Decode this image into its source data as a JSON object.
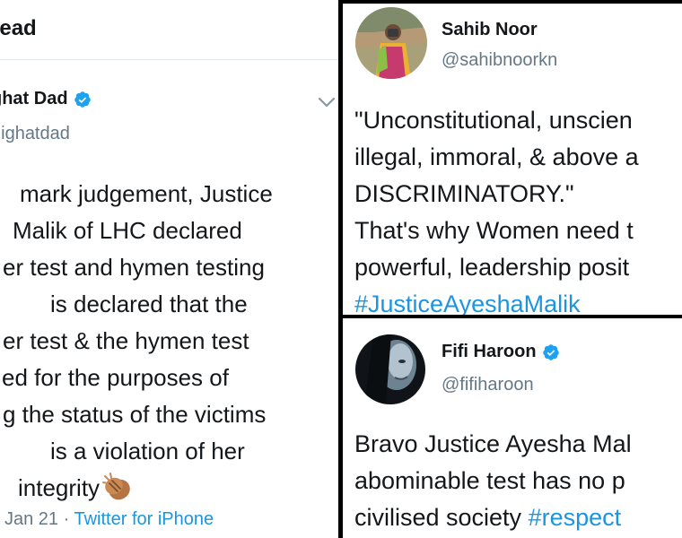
{
  "left_tweet": {
    "header": "read",
    "author_name": "ghat Dad",
    "author_handle": "nighatdad",
    "lines": [
      "mark judgement, Justice",
      "Malik of LHC declared",
      "er test and hymen testing",
      "is declared that the",
      "er test & the hymen test",
      "ed for the purposes of",
      "g the status of the victims",
      "is a violation of her",
      "integrity"
    ],
    "emoji": "clapping-hands",
    "date": "Jan 21",
    "separator": "·",
    "source": "Twitter for iPhone"
  },
  "top_right_tweet": {
    "author_name": "Sahib Noor",
    "author_handle": "@sahibnoorkn",
    "lines": [
      "\"Unconstitutional, unscien",
      "illegal, immoral, & above a",
      "DISCRIMINATORY.\"",
      "That's why Women need t",
      "powerful, leadership posit"
    ],
    "hashtag": "#JusticeAyeshaMalik"
  },
  "bottom_right_tweet": {
    "author_name": "Fifi Haroon",
    "author_handle": "@fifiharoon",
    "line1": "Bravo Justice Ayesha Mal",
    "line2": "abominable test has no p",
    "line3_text": "civilised society",
    "line3_hashtag": "#respect"
  },
  "colors": {
    "text": "#14171a",
    "secondary": "#657786",
    "link": "#1b95e0",
    "verified": "#1da1f2",
    "background": "#ffffff",
    "divider": "#000000"
  },
  "icons": [
    "verified-badge-icon",
    "chevron-down-icon",
    "clapping-hands-icon"
  ]
}
